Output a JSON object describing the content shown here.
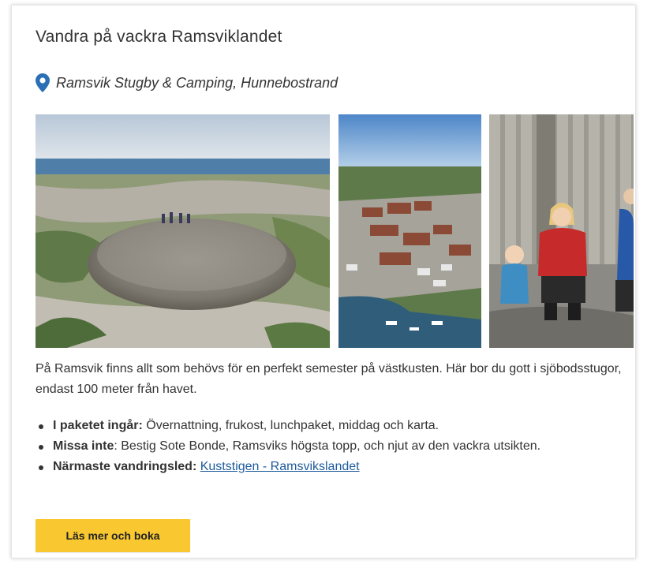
{
  "card": {
    "title": "Vandra på vackra Ramsviklandet",
    "location": "Ramsvik Stugby & Camping, Hunnebostrand",
    "description": "På Ramsvik finns allt som behövs för en perfekt semester på västkusten. Här bor du gott i sjöbodsstugor, endast 100 meter från havet.",
    "facts": [
      {
        "label": "I paketet ingår:",
        "text": " Övernattning, frukost, lunchpaket, middag och karta."
      },
      {
        "label": "Missa inte",
        "text": ": Bestig Sote Bonde, Ramsviks högsta topp, och njut av den vackra utsikten."
      },
      {
        "label": "Närmaste vandringsled:",
        "text": " ",
        "link": "Kuststigen - Ramsvikslandet"
      }
    ],
    "cta_label": "Läs mer och boka"
  },
  "colors": {
    "accent_button": "#f9c831",
    "link": "#1e5b9c",
    "pin": "#2a6fb5"
  }
}
